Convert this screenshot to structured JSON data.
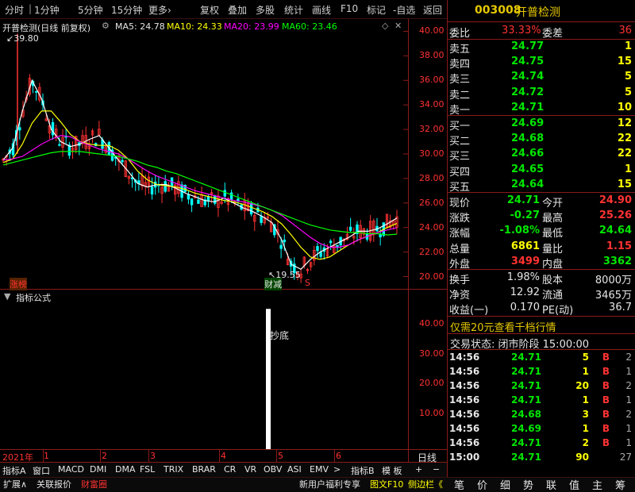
{
  "toolbar": {
    "items": [
      "分时",
      "1分钟",
      "5分钟",
      "15分钟",
      "更多›",
      "复权",
      "叠加",
      "多股",
      "统计",
      "画线",
      "F10",
      "标记",
      "-自选",
      "返回"
    ]
  },
  "chart_header": {
    "title": "开普检测(日线 前复权)",
    "ma5_label": "MA5: 24.78",
    "ma10_label": "MA10: 24.33",
    "ma20_label": "MA20: 23.99",
    "ma60_label": "MA60: 23.46",
    "high_label": "39.80",
    "low_label": "19.55",
    "tag_left": "涨榜",
    "tag_mid": "财减",
    "tag_s": "S",
    "indicator_title": "指标公式",
    "indicator_note": "抄底",
    "x_year": "2021年",
    "x_months": [
      "1",
      "2",
      "3",
      "4",
      "5",
      "6"
    ],
    "right_axis_word": "日线"
  },
  "chart_data": [
    {
      "type": "candlestick",
      "title": "开普检测(日线 前复权)",
      "ylim": [
        19,
        41
      ],
      "yticks": [
        20.0,
        22.0,
        24.0,
        26.0,
        28.0,
        30.0,
        32.0,
        34.0,
        36.0,
        38.0,
        40.0
      ],
      "x_labels": [
        "2021年",
        "1",
        "2",
        "3",
        "4",
        "5",
        "6"
      ],
      "series": [
        {
          "name": "MA5",
          "color": "#ffffff",
          "values": [
            29.5,
            30.5,
            33.5,
            36.0,
            34.5,
            32.0,
            31.0,
            30.6,
            30.8,
            31.2,
            31.5,
            30.5,
            29.5,
            28.6,
            27.6,
            27.3,
            27.5,
            27.5,
            27.2,
            26.8,
            26.5,
            26.2,
            26.1,
            26.4,
            26.0,
            25.6,
            25.3,
            24.9,
            24.4,
            23.0,
            21.0,
            20.6,
            21.4,
            22.0,
            22.4,
            22.8,
            23.2,
            23.7,
            23.7,
            23.9,
            24.3,
            24.78
          ]
        },
        {
          "name": "MA10",
          "color": "#ffff00",
          "values": [
            29.3,
            29.6,
            30.8,
            32.5,
            33.5,
            33.5,
            32.6,
            31.6,
            31.0,
            30.8,
            30.7,
            30.7,
            30.3,
            29.6,
            28.6,
            27.9,
            27.5,
            27.4,
            27.3,
            27.1,
            26.8,
            26.6,
            26.4,
            26.2,
            26.1,
            25.9,
            25.6,
            25.3,
            24.9,
            24.3,
            23.4,
            22.4,
            21.6,
            21.4,
            21.6,
            22.1,
            22.6,
            23.0,
            23.3,
            23.6,
            24.0,
            24.33
          ]
        },
        {
          "name": "MA20",
          "color": "#ff00ff",
          "values": [
            29.5,
            29.6,
            29.8,
            30.3,
            30.8,
            31.2,
            31.5,
            31.4,
            31.0,
            30.7,
            30.4,
            30.2,
            30.0,
            29.6,
            29.1,
            28.6,
            28.2,
            27.9,
            27.6,
            27.3,
            27.0,
            26.8,
            26.6,
            26.4,
            26.2,
            26.1,
            25.9,
            25.7,
            25.4,
            25.0,
            24.4,
            23.8,
            23.2,
            22.7,
            22.4,
            22.4,
            22.6,
            23.0,
            23.3,
            23.6,
            23.8,
            23.99
          ]
        },
        {
          "name": "MA60",
          "color": "#00ff00",
          "values": [
            29.1,
            29.3,
            29.5,
            29.7,
            29.9,
            30.1,
            30.2,
            30.2,
            30.2,
            30.1,
            30.0,
            29.9,
            29.8,
            29.6,
            29.4,
            29.1,
            28.9,
            28.6,
            28.4,
            28.1,
            27.8,
            27.5,
            27.2,
            26.9,
            26.6,
            26.3,
            26.0,
            25.7,
            25.4,
            25.1,
            24.8,
            24.5,
            24.2,
            24.0,
            23.8,
            23.7,
            23.6,
            23.6,
            23.5,
            23.5,
            23.4,
            23.46
          ]
        }
      ],
      "annotations": [
        {
          "text": "39.80",
          "value": 39.8
        },
        {
          "text": "19.55",
          "value": 19.55
        }
      ]
    },
    {
      "type": "bar",
      "title": "指标公式",
      "ylim": [
        0,
        48
      ],
      "yticks": [
        10.0,
        20.0,
        30.0,
        40.0
      ],
      "bars": [
        {
          "position": "5",
          "value": 45,
          "label": "抄底"
        }
      ]
    }
  ],
  "right_panel": {
    "code": "003008",
    "name": "开普检测",
    "weibi_label": "委比",
    "weibi_value": "33.33%",
    "weicha_label": "委差",
    "weicha_value": "36",
    "asks": [
      {
        "label": "卖五",
        "price": "24.77",
        "vol": "1"
      },
      {
        "label": "卖四",
        "price": "24.75",
        "vol": "15"
      },
      {
        "label": "卖三",
        "price": "24.74",
        "vol": "5"
      },
      {
        "label": "卖二",
        "price": "24.72",
        "vol": "5"
      },
      {
        "label": "卖一",
        "price": "24.71",
        "vol": "10"
      }
    ],
    "bids": [
      {
        "label": "买一",
        "price": "24.69",
        "vol": "12"
      },
      {
        "label": "买二",
        "price": "24.68",
        "vol": "22"
      },
      {
        "label": "买三",
        "price": "24.66",
        "vol": "22"
      },
      {
        "label": "买四",
        "price": "24.65",
        "vol": "1"
      },
      {
        "label": "买五",
        "price": "24.64",
        "vol": "15"
      }
    ],
    "stats": [
      {
        "l1": "现价",
        "v1": "24.71",
        "c1": "green",
        "l2": "今开",
        "v2": "24.90",
        "c2": "red"
      },
      {
        "l1": "涨跌",
        "v1": "-0.27",
        "c1": "green",
        "l2": "最高",
        "v2": "25.26",
        "c2": "red"
      },
      {
        "l1": "涨幅",
        "v1": "-1.08%",
        "c1": "green",
        "l2": "最低",
        "v2": "24.64",
        "c2": "green"
      },
      {
        "l1": "总量",
        "v1": "6861",
        "c1": "yellow",
        "l2": "量比",
        "v2": "1.15",
        "c2": "red"
      },
      {
        "l1": "外盘",
        "v1": "3499",
        "c1": "red",
        "l2": "内盘",
        "v2": "3362",
        "c2": "green"
      }
    ],
    "stats2": [
      {
        "l1": "换手",
        "v1": "1.98%",
        "l2": "股本",
        "v2": "8000万"
      },
      {
        "l1": "净资",
        "v1": "12.92",
        "l2": "流通",
        "v2": "3465万"
      },
      {
        "l1": "收益(一)",
        "v1": "0.170",
        "l2": "PE(动)",
        "v2": "36.7"
      }
    ],
    "promo": "仅需20元查看千档行情",
    "trade_status": "交易状态: 闭市阶段 15:00:00",
    "ticks": [
      {
        "t": "14:56",
        "p": "24.71",
        "v": "5",
        "bs": "B",
        "n": "2"
      },
      {
        "t": "14:56",
        "p": "24.71",
        "v": "1",
        "bs": "B",
        "n": "1"
      },
      {
        "t": "14:56",
        "p": "24.71",
        "v": "20",
        "bs": "B",
        "n": "2"
      },
      {
        "t": "14:56",
        "p": "24.71",
        "v": "1",
        "bs": "B",
        "n": "1"
      },
      {
        "t": "14:56",
        "p": "24.68",
        "v": "3",
        "bs": "B",
        "n": "2"
      },
      {
        "t": "14:56",
        "p": "24.69",
        "v": "1",
        "bs": "B",
        "n": "1"
      },
      {
        "t": "14:56",
        "p": "24.71",
        "v": "2",
        "bs": "B",
        "n": "1"
      },
      {
        "t": "15:00",
        "p": "24.71",
        "v": "90",
        "bs": "",
        "n": "27"
      }
    ],
    "nav": [
      "笔",
      "价",
      "细",
      "势",
      "联",
      "值",
      "主",
      "筹"
    ]
  },
  "bottom_tabs": {
    "row1": [
      "指标A",
      "窗口",
      "MACD",
      "DMI",
      "DMA",
      "FSL",
      "TRIX",
      "BRAR",
      "CR",
      "VR",
      "OBV",
      "ASI",
      "EMV",
      ">",
      "指标B",
      "模 板",
      "+",
      "−"
    ],
    "row2": [
      "扩展∧",
      "关联报价",
      "财富圈",
      "新用户福利专享",
      "图文F10",
      "侧边栏《"
    ]
  }
}
